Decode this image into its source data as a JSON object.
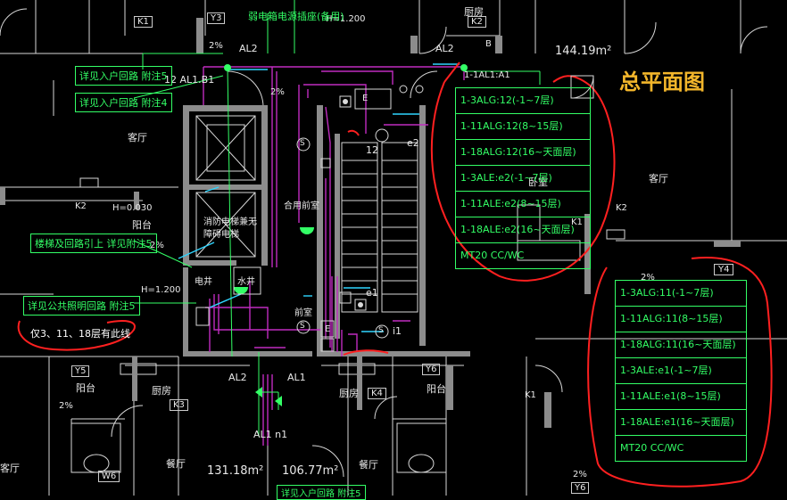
{
  "title": "总平面图",
  "area_top_right": "144.19m²",
  "area_bottom_a": "131.18m²",
  "area_bottom_b": "106.77m²",
  "room_labels": {
    "living_left": "客厅",
    "living_right": "客厅",
    "dining_bottom": "餐厅",
    "kitchen_left": "厨房",
    "kitchen_right": "厨房",
    "kitchen_top": "厨房",
    "balcony_left": "阳台",
    "balcony_bottom_left": "阳台",
    "balcony_bottom_right": "阳台",
    "lobby": "合用前室",
    "front_room": "前室",
    "elevator": "消防电梯兼无障碍电梯",
    "well": "电井",
    "water_well": "水井",
    "bedroom": "卧室",
    "living_bottom_left": "客厅",
    "dining_bottom_right": "餐厅"
  },
  "codes": {
    "k1_top": "K1",
    "y3": "Y3",
    "k2_top": "K2",
    "b": "B",
    "k2_left": "K2",
    "k1_right": "K1",
    "k2_right": "K2",
    "y4": "Y4",
    "y5": "Y5",
    "y6": "Y6",
    "k3": "K3",
    "k4": "K4",
    "k1_bottom": "K1",
    "w6": "W6",
    "y6_bottom": "Y6",
    "e": "E",
    "e_lower": "E"
  },
  "heights": {
    "h_top": "H=1.200",
    "h_left": "H=0.030",
    "h_mid": "H=1.200"
  },
  "slopes": {
    "s1": "2%",
    "s2": "2%",
    "s3": "2%",
    "s4": "2%",
    "s5": "2%",
    "s6": "2%"
  },
  "cad_tags": {
    "al2_left": "AL2",
    "al2_right": "AL2",
    "al1_b": "12 AL1.B1",
    "al1_a": "1-1AL1:A1",
    "t12": "12",
    "e2": "e2",
    "e1": "e1",
    "i1": "i1",
    "al2_bottom": "AL2",
    "al1_bottom": "AL1",
    "al1_n1": "AL1 n1",
    "d1": "S",
    "d2": "S",
    "d3": "S"
  },
  "notes": {
    "top_note": "弱电箱电源插座(备用)",
    "note1": "详见入户回路 附注5",
    "note2": "详见入户回路 附注4",
    "note3": "楼梯及回路引上 详见附注5",
    "note4": "详见公共照明回路 附注5",
    "note5": "仅3、11、18层有此线",
    "note_bottom": "详见入户回路 附注5"
  },
  "table_right": {
    "rows": [
      "1-3ALG:12(-1~7层)",
      "1-11ALG:12(8~15层)",
      "1-18ALG:12(16~天面层)",
      "1-3ALE:e2(-1~7层)",
      "1-11ALE:e2(8~15层)",
      "1-18ALE:e2(16~天面层)",
      "MT20 CC/WC"
    ]
  },
  "table_bottom": {
    "rows": [
      "1-3ALG:11(-1~7层)",
      "1-11ALG:11(8~15层)",
      "1-18ALG:11(16~天面层)",
      "1-3ALE:e1(-1~7层)",
      "1-11ALE:e1(8~15层)",
      "1-18ALE:e1(16~天面层)",
      "MT20 CC/WC"
    ]
  },
  "colors": {
    "background": "#000000",
    "wall": "#8c8c8c",
    "green": "#33ff66",
    "magenta": "#c02cc0",
    "cyan": "#2fd5ff",
    "red": "#ff2020",
    "orange": "#f3b62b",
    "white": "#e8e8e8"
  }
}
